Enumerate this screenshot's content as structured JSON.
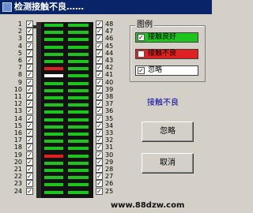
{
  "window": {
    "title": "检测接触不良……"
  },
  "left_pins": [
    "1",
    "2",
    "3",
    "4",
    "5",
    "6",
    "7",
    "8",
    "9",
    "10",
    "11",
    "12",
    "13",
    "14",
    "15",
    "16",
    "17",
    "18",
    "19",
    "20",
    "21",
    "22",
    "23",
    "24"
  ],
  "right_pins": [
    "48",
    "47",
    "46",
    "45",
    "44",
    "43",
    "42",
    "41",
    "40",
    "39",
    "38",
    "37",
    "36",
    "35",
    "34",
    "33",
    "32",
    "31",
    "30",
    "29",
    "28",
    "27",
    "26",
    "25"
  ],
  "left_checks": [
    "✓",
    "✓",
    "✓",
    "✓",
    "✓",
    "✓",
    "✓",
    "✓",
    "✓",
    "✓",
    "✓",
    "✓",
    "✓",
    "✓",
    "✓",
    "✓",
    "✓",
    "✓",
    "✓",
    "✓",
    "✓",
    "✓",
    "✓",
    "✓"
  ],
  "right_checks": [
    "✓",
    "✓",
    "✓",
    "✓",
    "✓",
    "✓",
    "✓",
    "✓",
    "✓",
    "✓",
    "✓",
    "✓",
    "✓",
    "✓",
    "✓",
    "✓",
    "✓",
    "✓",
    "✓",
    "✓",
    "✓",
    "✓",
    "✓",
    "✓"
  ],
  "legend": {
    "title": "图例",
    "good": {
      "label": "接触良好",
      "check": "✓",
      "color": "#1cc41c"
    },
    "bad": {
      "label": "接触不良",
      "check": "",
      "color": "#e02020"
    },
    "ignore": {
      "label": "忽略",
      "check": "✓",
      "color": "#ffffff"
    }
  },
  "status": "接触不良",
  "buttons": {
    "ignore": "忽略",
    "cancel": "取消"
  },
  "watermark": "www.88dzw.com",
  "colors": {
    "good": "#1cc41c",
    "bad": "#e02020",
    "ignore": "#ffffff",
    "socket": "#121212"
  },
  "pin_states": [
    "good",
    "good",
    "good",
    "good",
    "good",
    "good",
    "bad",
    "ignore",
    "good",
    "good",
    "good",
    "good",
    "good",
    "good",
    "good",
    "good",
    "good",
    "good",
    "bad",
    "good",
    "good",
    "good",
    "good",
    "good",
    "good",
    "good",
    "good",
    "good",
    "good",
    "good",
    "good",
    "good",
    "good",
    "good",
    "good",
    "good",
    "good",
    "good",
    "good",
    "good",
    "good",
    "good",
    "good",
    "good",
    "good",
    "good",
    "good",
    "good"
  ]
}
